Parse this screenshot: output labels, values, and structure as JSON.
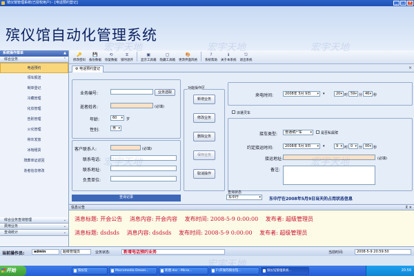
{
  "window": {
    "title": "殡仪馆管理系统(已授权用户) - [电话预约登记]",
    "buttons": [
      "_",
      "□",
      "×"
    ]
  },
  "banner": {
    "app_title": "殡仪馆自动化管理系统",
    "watermark": "宏宇天地"
  },
  "sidebar": {
    "header": "系统操作菜单",
    "top_category": "综合业务",
    "items": [
      {
        "label": "电话预约",
        "active": true
      },
      {
        "label": "领车报送"
      },
      {
        "label": "制单登记"
      },
      {
        "label": "冷藏管理"
      },
      {
        "label": "化妆管理"
      },
      {
        "label": "告别管理"
      },
      {
        "label": "火化管理"
      },
      {
        "label": "骨灰发放"
      },
      {
        "label": "冰棺租赁"
      },
      {
        "label": "殡葬单证返回"
      },
      {
        "label": "逝者信息修改"
      }
    ],
    "bottom_categories": [
      "综合业务查询管理",
      "费用业务",
      "查询统计"
    ]
  },
  "toolbar": {
    "buttons": [
      {
        "label": "修改密码",
        "icon": "🔑"
      },
      {
        "label": "备份数据",
        "icon": "💾"
      },
      {
        "label": "恢复数据",
        "icon": "⟲"
      },
      {
        "label": "锁时退开",
        "icon": "⧖"
      },
      {
        "label": "显示工具箱",
        "icon": "▣"
      },
      {
        "label": "隐藏工具箱",
        "icon": "▢"
      },
      {
        "label": "更改界面风格",
        "icon": "🎨"
      },
      {
        "label": "系统帮助",
        "icon": "?"
      },
      {
        "label": "关于本系统",
        "icon": "ℹ"
      },
      {
        "label": "退出系统",
        "icon": "⎋"
      }
    ]
  },
  "tab": {
    "label": "电话预约登记",
    "icon": "⚙"
  },
  "form": {
    "biz_no_label": "业务编号:",
    "biz_query_btn": "业务选取",
    "deceased_label": "逝者姓名:",
    "required_hint": "(必填)",
    "age_label": "年龄:",
    "age_value": "60",
    "age_unit": "岁",
    "gender_label": "性别:",
    "gender_value": "男",
    "contact_label": "客户联系人:",
    "phone_label": "联系电话:",
    "address_label": "联系地址:",
    "unit_label": "负责单位:",
    "query_record_btn": "查询记录",
    "ops_group_title": "功能操作区",
    "ops_buttons": [
      "新增业务",
      "修改业务",
      "删除业务",
      "保存业务",
      "取消操作"
    ],
    "call_time_label": "来电时间:",
    "call_date": "2008年 5月 9日",
    "call_h": "20",
    "call_m": "59",
    "call_s": "46",
    "hour_unit": "时",
    "minute_unit": "分",
    "second_unit": "秒",
    "dispatch_vehicle_label": "派遣灵车",
    "vehicle_type_label": "接车类型:",
    "vehicle_type_value": "普通殡尸车",
    "vehicle_extra_check": "是否私属殡",
    "pickup_time_label": "约定接运时间:",
    "pickup_date": "2008年 5月 9日",
    "pickup_h": "9",
    "pickup_m": "0",
    "pickup_s": "00",
    "pickup_addr_label": "接运地址:",
    "remarks_label": "备注:",
    "query_status_label": "查询状态",
    "query_status_value": "东中厅",
    "hall_notice": "东中厅在2008年5月9日当天的占用状态信息"
  },
  "board": {
    "title": "信息公告",
    "notices": [
      {
        "title_label": "消息标题:",
        "title": "开会公告",
        "content_label": "消息内容:",
        "content": "开会内容",
        "time_label": "发布时间:",
        "time": "2008-5-9 0:00:00",
        "publisher_label": "发布者:",
        "publisher": "超级管理员"
      },
      {
        "title_label": "消息标题:",
        "title": "dsdsds",
        "content_label": "消息内容:",
        "content": "dsdsds",
        "time_label": "发布时间:",
        "time": "2008-5-9 0:00:00",
        "publisher_label": "发布者:",
        "publisher": "超级管理员"
      }
    ]
  },
  "statusbar": {
    "operator_label": "当前操作员:",
    "operator": "admin",
    "role": "超级管理员",
    "status_label": "业务状态:",
    "status": "新增电话预约业务",
    "time_label": "当前时间:",
    "time": "2008-5-9 20:59:50"
  },
  "taskbar": {
    "start": "开始",
    "tasks": [
      "殡仪馆",
      "Macromedia Dream...",
      "新建.doc - Micro...",
      "F:\\开发的殡仪馆...",
      "殡仪馆管理系统..."
    ],
    "tray_time": "20:59"
  }
}
